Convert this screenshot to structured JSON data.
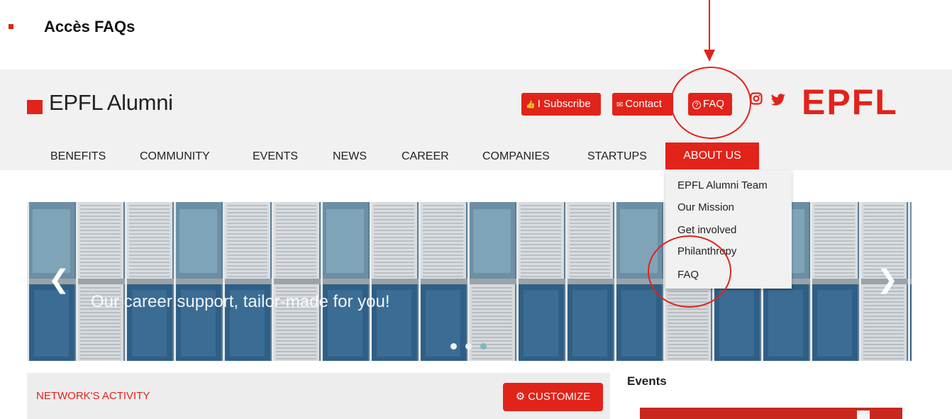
{
  "document": {
    "heading": "Accès FAQs"
  },
  "header": {
    "logo_text": "EPFL Alumni",
    "buttons": [
      {
        "label": "I Subscribe",
        "icon": "thumbs-up-icon",
        "glyph": "👍"
      },
      {
        "label": "Contact",
        "icon": "envelope-icon",
        "glyph": "✉"
      },
      {
        "label": "FAQ",
        "icon": "question-circle-icon",
        "glyph": "?"
      }
    ],
    "brand_text": "EPFL"
  },
  "nav": {
    "items": [
      "BENEFITS",
      "COMMUNITY",
      "EVENTS",
      "NEWS",
      "CAREER",
      "COMPANIES",
      "STARTUPS",
      "ABOUT US"
    ]
  },
  "dropdown": {
    "items": [
      "EPFL Alumni Team",
      "Our Mission",
      "Get involved",
      "Philanthropy",
      "FAQ"
    ]
  },
  "hero": {
    "caption": "Our career support, tailor-made for you!",
    "prev_glyph": "❮",
    "next_glyph": "❯"
  },
  "activity": {
    "title": "NETWORK'S ACTIVITY",
    "customize_label": "CUSTOMIZE",
    "customize_glyph": "⚙"
  },
  "events": {
    "title": "Events"
  },
  "colors": {
    "brand_red": "#e2231a",
    "header_bg": "#f1f1f1",
    "annotation_red": "#e2231a"
  }
}
